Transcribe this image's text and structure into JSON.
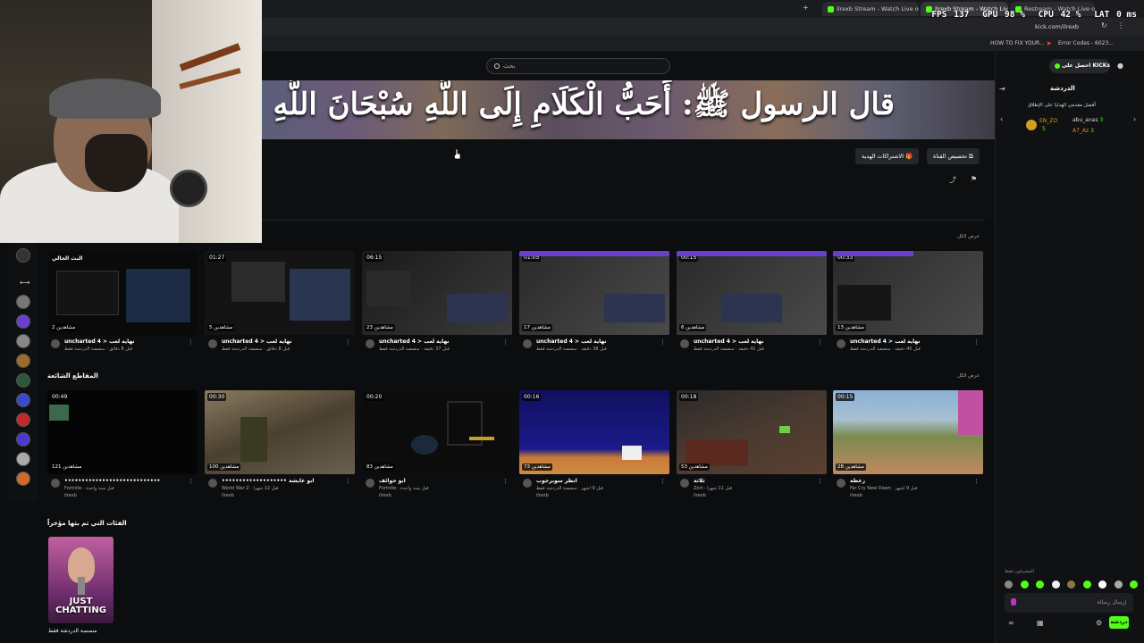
{
  "browser": {
    "tabs": [
      {
        "label": "Restream - Watch Live on Kick",
        "active": false
      },
      {
        "label": "Ilrexb Stream - Watch Live on Kick",
        "active": true
      },
      {
        "label": "ilrexb Stream - Watch Live on K",
        "active": false
      }
    ],
    "url": "kick.com/ilrexb",
    "bookmarks": [
      "HOW TO FIX YOUR...",
      "Error Codes - 6023..."
    ]
  },
  "perf_overlay": {
    "fps_label": "FPS",
    "fps": "137",
    "gpu_label": "GPU",
    "gpu": "98 %",
    "cpu_label": "CPU",
    "cpu": "42 %",
    "lat_label": "LAT",
    "lat": "0 ms"
  },
  "search": {
    "placeholder": "بحث"
  },
  "banner": {
    "text": "قال الرسول ﷺ: أَحَبُّ الْكَلَامِ إِلَى اللَّهِ سُبْحَانَ اللَّهِ"
  },
  "channel_actions": {
    "subscribe_label": "الاشتراكات الهدية",
    "customize_label": "تخصيص القناة"
  },
  "sections": {
    "videos": {
      "title": "البث السابق",
      "see_all": "عرض الكل"
    },
    "clips": {
      "title": "المقاطع الشائعة",
      "see_all": "عرض الكل"
    },
    "categories": {
      "title": "الفئات التي تم بثها مؤخراً"
    }
  },
  "videos": [
    {
      "duration": "",
      "views": "2 مشاهدين",
      "title": "uncharted 4 > نهاية لعب",
      "sub": "قبل 8 دقائق · منصصة الدردشة فقط",
      "label": "البث الحالي"
    },
    {
      "duration": "01:27",
      "views": "5 مشاهدين",
      "title": "uncharted 4 > نهاية لعب",
      "sub": "قبل 8 دقائق · منصصة الدردشة فقط",
      "label": ""
    },
    {
      "duration": "06:15",
      "views": "23 مشاهدين",
      "title": "uncharted 4 > نهاية لعب",
      "sub": "قبل 37 دقيقة · منصصة الدردشة فقط",
      "label": ""
    },
    {
      "duration": "01:05",
      "views": "17 مشاهدين",
      "title": "uncharted 4 > نهاية لعب",
      "sub": "قبل 38 دقيقة · منصصة الدردشة فقط",
      "label": ""
    },
    {
      "duration": "00:15",
      "views": "6 مشاهدين",
      "title": "uncharted 4 > نهاية لعب",
      "sub": "قبل 41 دقيقة · منصصة الدردشة فقط",
      "label": ""
    },
    {
      "duration": "00:33",
      "views": "13 مشاهدين",
      "title": "uncharted 4 > نهاية لعب",
      "sub": "قبل 45 دقيقة · منصصة الدردشة فقط",
      "label": ""
    }
  ],
  "clips": [
    {
      "duration": "00:49",
      "views": "121 مشاهدين",
      "title": "••••••••••••••••••••••••••••",
      "sub": "Fortnite · قبل سنة واحدة",
      "channel": "ilrexb"
    },
    {
      "duration": "00:30",
      "views": "100 مشاهدين",
      "title": "••••••••••••••••••• ابو عايشة",
      "sub": "World War Z · قبل 12 شهراً",
      "channel": "ilrexb"
    },
    {
      "duration": "00:20",
      "views": "83 مشاهدين",
      "title": "ابو حوائف",
      "sub": "Fortnite · قبل سنة واحدة",
      "channel": "ilrexb"
    },
    {
      "duration": "00:16",
      "views": "73 مشاهدين",
      "title": "انظر سوبرجوب",
      "sub": "قبل 9 أشهر · منصصة الدردشة فقط",
      "channel": "ilrexb"
    },
    {
      "duration": "00:18",
      "views": "53 مشاهدين",
      "title": "ثلاثة",
      "sub": "Zort · قبل 11 شهراً",
      "channel": "ilrexb"
    },
    {
      "duration": "00:15",
      "views": "28 مشاهدين",
      "title": "زعطه",
      "sub": "Far Cry New Dawn · قبل 9 أشهر",
      "channel": "ilrexb"
    }
  ],
  "category": {
    "art_text": "JUST CHATTING",
    "label": "منصصة الدردشة فقط"
  },
  "chat": {
    "kick_pill": "احصل على KICKs",
    "title": "الدردشة",
    "top_gifters_label": "أفضل مقدمي الهدايا على الإطلاق",
    "gifters": [
      {
        "name": "EN_ZO",
        "count": "5"
      },
      {
        "name": "abu_anas",
        "count": "3"
      },
      {
        "name": "A7_Az",
        "count": "3"
      }
    ],
    "input_placeholder": "إرسال رسالة",
    "send_label": "دردشة",
    "mods_label": "المشرفون فقط"
  },
  "colors": {
    "kick_green": "#53fc18",
    "bg": "#0b0d0f"
  }
}
